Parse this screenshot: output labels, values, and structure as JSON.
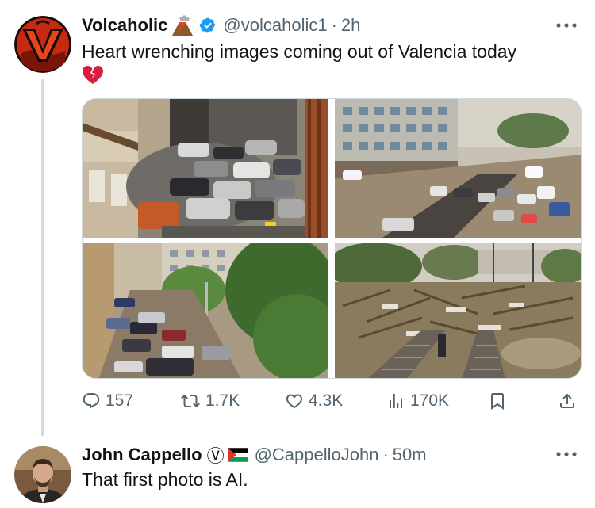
{
  "tweet": {
    "author_name": "Volcaholic",
    "author_emoji": "volcano-emoji",
    "handle": "@volcaholic1",
    "separator": "·",
    "time": "2h",
    "text": "Heart wrenching images coming out of Valencia today",
    "text_emoji": "broken-heart-emoji",
    "images": [
      {
        "icon": "street-cars-piled-photo"
      },
      {
        "icon": "flooded-street-aerial-photo"
      },
      {
        "icon": "flooded-cars-trees-photo"
      },
      {
        "icon": "debris-railway-photo"
      }
    ],
    "stats": {
      "replies": "157",
      "reposts": "1.7K",
      "likes": "4.3K",
      "views": "170K"
    }
  },
  "reply": {
    "author_name": "John Cappello",
    "badge": "Ⓥ",
    "handle": "@CappelloJohn",
    "separator": "·",
    "time": "50m",
    "text": "That first photo is AI."
  },
  "colors": {
    "text": "#0f1419",
    "secondary": "#536471",
    "verified": "#1d9bf0",
    "thread_line": "#cfd9de"
  }
}
